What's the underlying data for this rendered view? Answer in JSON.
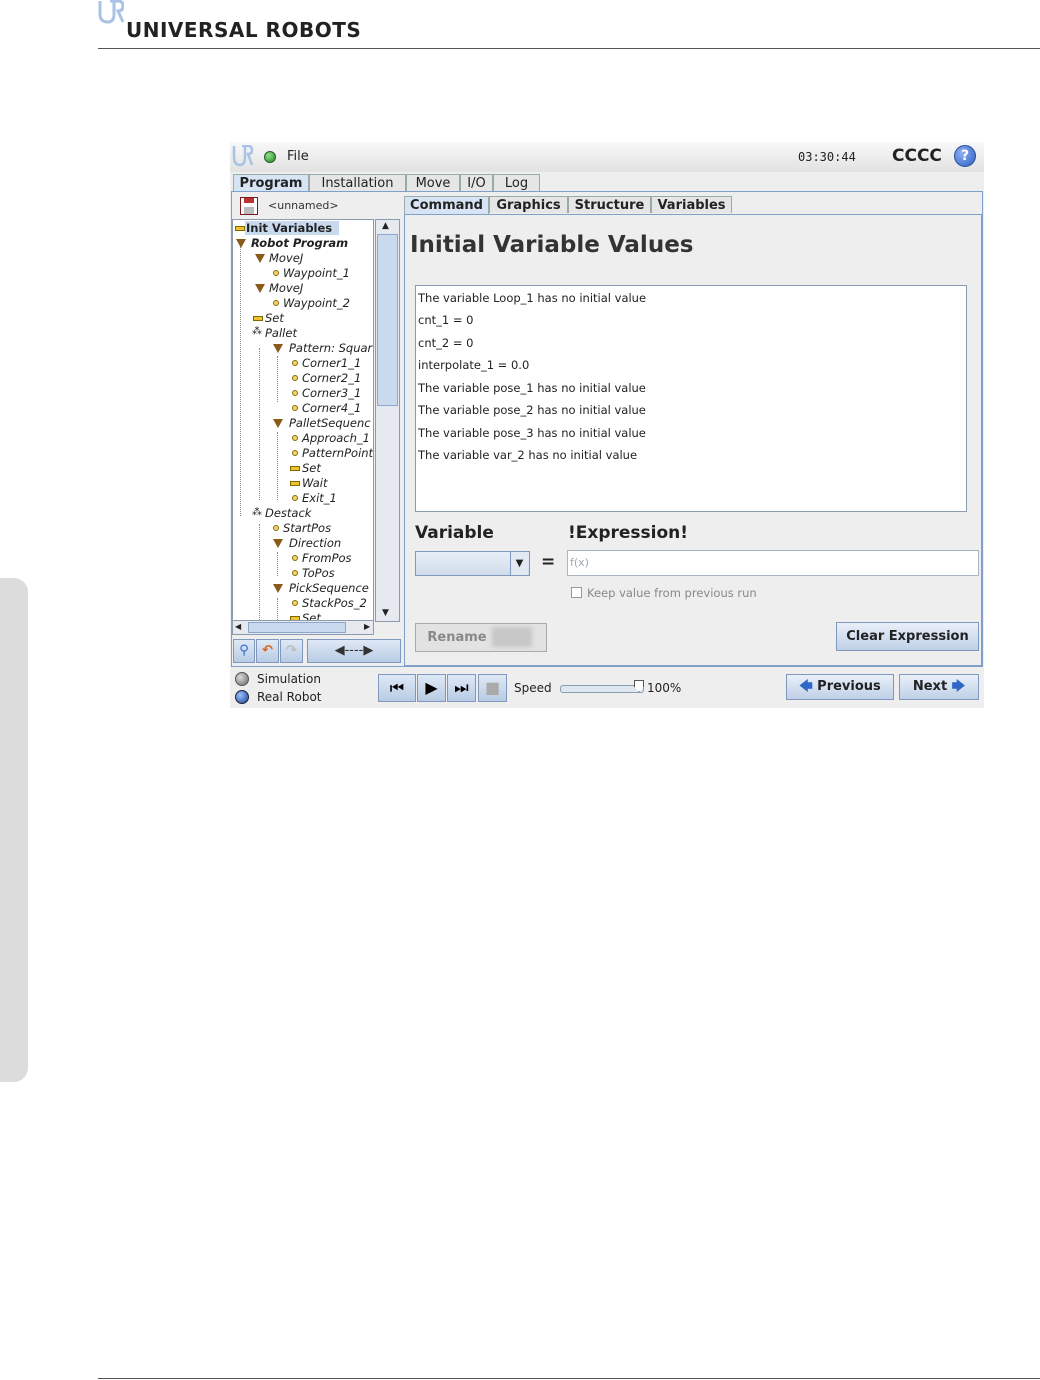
{
  "page": {
    "brand": "UNIVERSAL ROBOTS"
  },
  "topbar": {
    "file_menu": "File",
    "clock": "03:30:44",
    "robot_name": "CCCC",
    "help_icon": "?"
  },
  "main_tabs": [
    "Program",
    "Installation",
    "Move",
    "I/O",
    "Log"
  ],
  "program_name": "<unnamed>",
  "tree": [
    {
      "label": "Init Variables",
      "icon": "bar-icon",
      "selected": true
    },
    {
      "label": "Robot Program",
      "icon": "triangle-icon"
    },
    {
      "label": "MoveJ",
      "icon": "triangle-icon"
    },
    {
      "label": "Waypoint_1",
      "icon": "dot-icon"
    },
    {
      "label": "MoveJ",
      "icon": "triangle-icon"
    },
    {
      "label": "Waypoint_2",
      "icon": "dot-icon"
    },
    {
      "label": "Set",
      "icon": "bar-icon"
    },
    {
      "label": "Pallet",
      "icon": "pallet-icon"
    },
    {
      "label": "Pattern: Squar",
      "icon": "triangle-icon"
    },
    {
      "label": "Corner1_1",
      "icon": "dot-icon"
    },
    {
      "label": "Corner2_1",
      "icon": "dot-icon"
    },
    {
      "label": "Corner3_1",
      "icon": "dot-icon"
    },
    {
      "label": "Corner4_1",
      "icon": "dot-icon"
    },
    {
      "label": "PalletSequenc",
      "icon": "triangle-icon"
    },
    {
      "label": "Approach_1",
      "icon": "dot-icon"
    },
    {
      "label": "PatternPoint",
      "icon": "dot-icon"
    },
    {
      "label": "Set",
      "icon": "bar-icon"
    },
    {
      "label": "Wait",
      "icon": "bar-icon"
    },
    {
      "label": "Exit_1",
      "icon": "dot-icon"
    },
    {
      "label": "Destack",
      "icon": "pallet-icon"
    },
    {
      "label": "StartPos",
      "icon": "dot-icon"
    },
    {
      "label": "Direction",
      "icon": "triangle-icon"
    },
    {
      "label": "FromPos",
      "icon": "dot-icon"
    },
    {
      "label": "ToPos",
      "icon": "dot-icon"
    },
    {
      "label": "PickSequence",
      "icon": "triangle-icon"
    },
    {
      "label": "StackPos_2",
      "icon": "dot-icon"
    },
    {
      "label": "Set",
      "icon": "bar-icon"
    }
  ],
  "sub_tabs": [
    "Command",
    "Graphics",
    "Structure",
    "Variables"
  ],
  "panel": {
    "title": "Initial Variable Values",
    "variables": [
      "The variable Loop_1 has no initial value",
      "cnt_1 = 0",
      "cnt_2 = 0",
      "interpolate_1 = 0.0",
      "The variable pose_1 has no initial value",
      "The variable pose_2 has no initial value",
      "The variable pose_3 has no initial value",
      "The variable var_2 has no initial value"
    ],
    "variable_label": "Variable",
    "equals": "=",
    "expression_label": "!Expression!",
    "expression_placeholder": "f(x)",
    "keep_value_label": "Keep value from previous run",
    "rename_label": "Rename",
    "clear_label": "Clear Expression"
  },
  "bottom": {
    "simulation_label": "Simulation",
    "real_robot_label": "Real Robot",
    "speed_label": "Speed",
    "speed_value": "100%",
    "speed_fraction": 1.0,
    "previous_label": "Previous",
    "next_label": "Next"
  },
  "colors": {
    "accent": "#2e67c7",
    "selected_row": "#c9d9ee",
    "frame_border": "#7fa0c8"
  }
}
